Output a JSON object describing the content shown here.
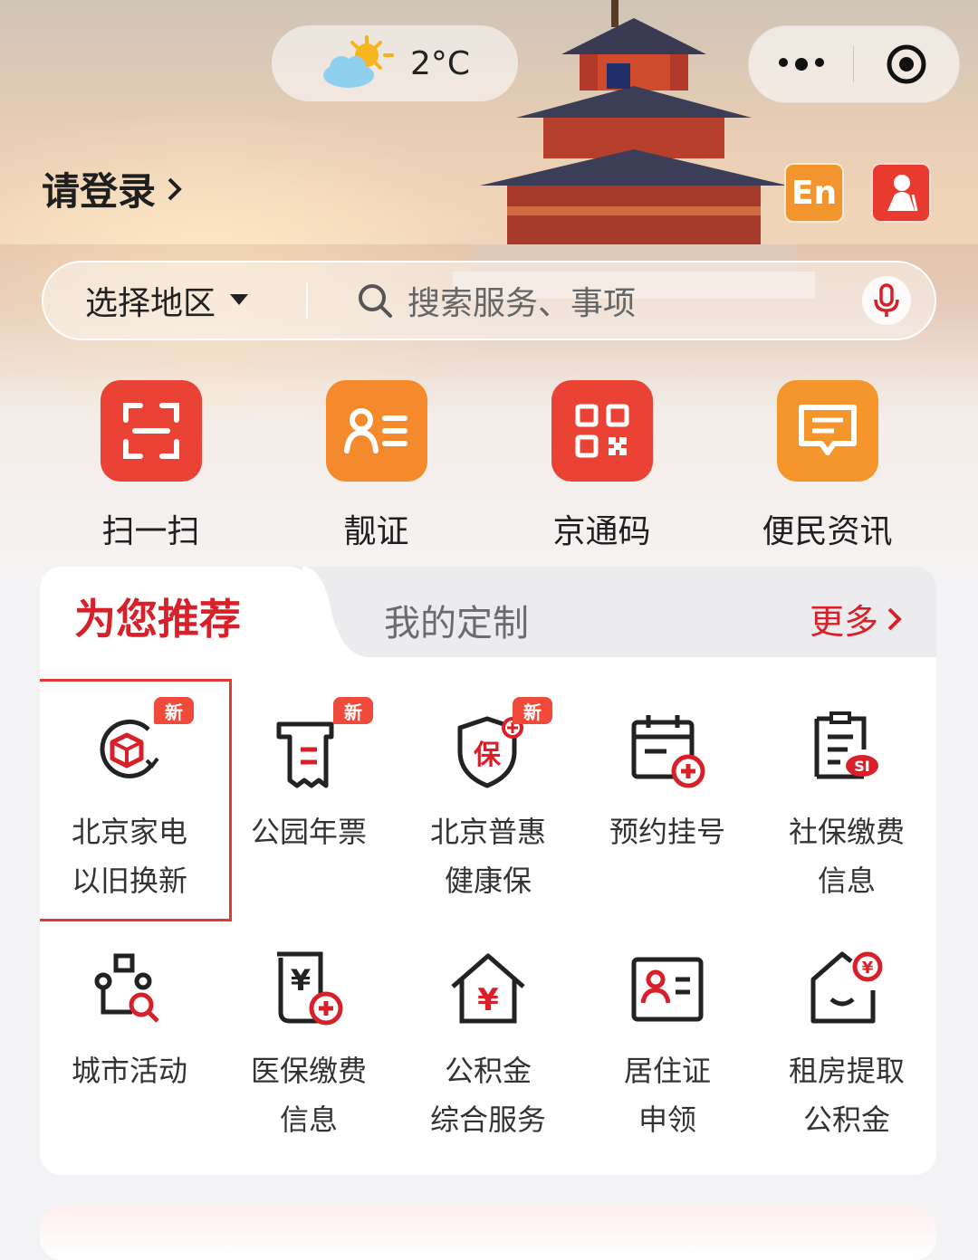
{
  "status": {
    "weather_icon": "partly-cloudy-sun-icon",
    "temperature": "2°C"
  },
  "capsule": {
    "more_icon": "more-dots-icon",
    "close_icon": "mini-program-close-icon"
  },
  "header": {
    "login_label": "请登录",
    "english_badge": "En",
    "elder_mode_icon": "elder-mode-icon"
  },
  "search": {
    "region_label": "选择地区",
    "placeholder": "搜索服务、事项",
    "mic_icon": "microphone-icon"
  },
  "quick_actions": [
    {
      "label": "扫一扫",
      "icon": "scan-icon",
      "color": "#ea4335"
    },
    {
      "label": "靓证",
      "icon": "id-card-icon",
      "color": "#f58a2c"
    },
    {
      "label": "京通码",
      "icon": "qr-code-icon",
      "color": "#ea4335"
    },
    {
      "label": "便民资讯",
      "icon": "message-icon",
      "color": "#f5962c"
    }
  ],
  "tabs": {
    "recommended": "为您推荐",
    "custom": "我的定制",
    "more": "更多"
  },
  "services": {
    "new_tag": "新",
    "items": [
      {
        "line1": "北京家电",
        "line2": "以旧换新",
        "icon": "appliance-trade-in-icon"
      },
      {
        "line1": "公园年票",
        "line2": "",
        "icon": "park-ticket-icon"
      },
      {
        "line1": "北京普惠",
        "line2": "健康保",
        "icon": "health-insurance-shield-icon"
      },
      {
        "line1": "预约挂号",
        "line2": "",
        "icon": "calendar-add-icon"
      },
      {
        "line1": "社保缴费",
        "line2": "信息",
        "icon": "social-security-document-icon"
      },
      {
        "line1": "城市活动",
        "line2": "",
        "icon": "city-activity-icon"
      },
      {
        "line1": "医保缴费",
        "line2": "信息",
        "icon": "medical-insurance-receipt-icon"
      },
      {
        "line1": "公积金",
        "line2": "综合服务",
        "icon": "housing-fund-house-icon"
      },
      {
        "line1": "居住证",
        "line2": "申领",
        "icon": "residence-permit-icon"
      },
      {
        "line1": "租房提取",
        "line2": "公积金",
        "icon": "rent-withdraw-icon"
      }
    ]
  },
  "colors": {
    "brand_red": "#d8202a",
    "orange": "#f2952f"
  }
}
